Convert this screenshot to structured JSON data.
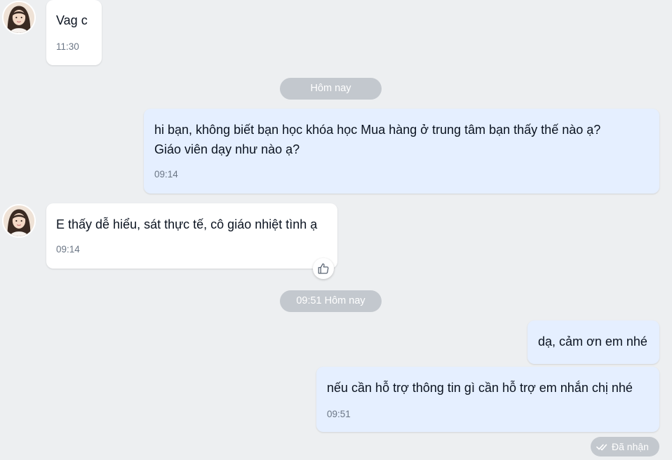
{
  "colors": {
    "background": "#edeff1",
    "incoming_bubble": "#ffffff",
    "outgoing_bubble": "#e5efff",
    "divider_pill": "#c3c8ce",
    "time_text": "#6b7685"
  },
  "messages": [
    {
      "id": "m1",
      "direction": "incoming",
      "lines": [
        "Vag c"
      ],
      "time": "11:30",
      "avatar": "contact-avatar"
    },
    {
      "id": "m2",
      "direction": "outgoing",
      "lines": [
        "hi bạn, không biết bạn học khóa học Mua hàng ở trung tâm bạn thấy thế nào ạ?",
        "Giáo viên dạy như nào ạ?"
      ],
      "time": "09:14"
    },
    {
      "id": "m3",
      "direction": "incoming",
      "lines": [
        "E thấy dễ hiểu, sát thực tế, cô giáo nhiệt tình ạ"
      ],
      "time": "09:14",
      "avatar": "contact-avatar",
      "reaction_icon": "thumbs-up-icon"
    },
    {
      "id": "m4",
      "direction": "outgoing",
      "lines": [
        "dạ, cảm ơn em nhé"
      ]
    },
    {
      "id": "m5",
      "direction": "outgoing",
      "lines": [
        "nếu cần hỗ trợ thông tin gì cần hỗ trợ em nhắn chị nhé"
      ],
      "time": "09:51"
    }
  ],
  "dividers": {
    "first": "Hôm nay",
    "second": "09:51 Hôm nay"
  },
  "status": {
    "label": "Đã nhận",
    "icon": "double-check-icon"
  }
}
